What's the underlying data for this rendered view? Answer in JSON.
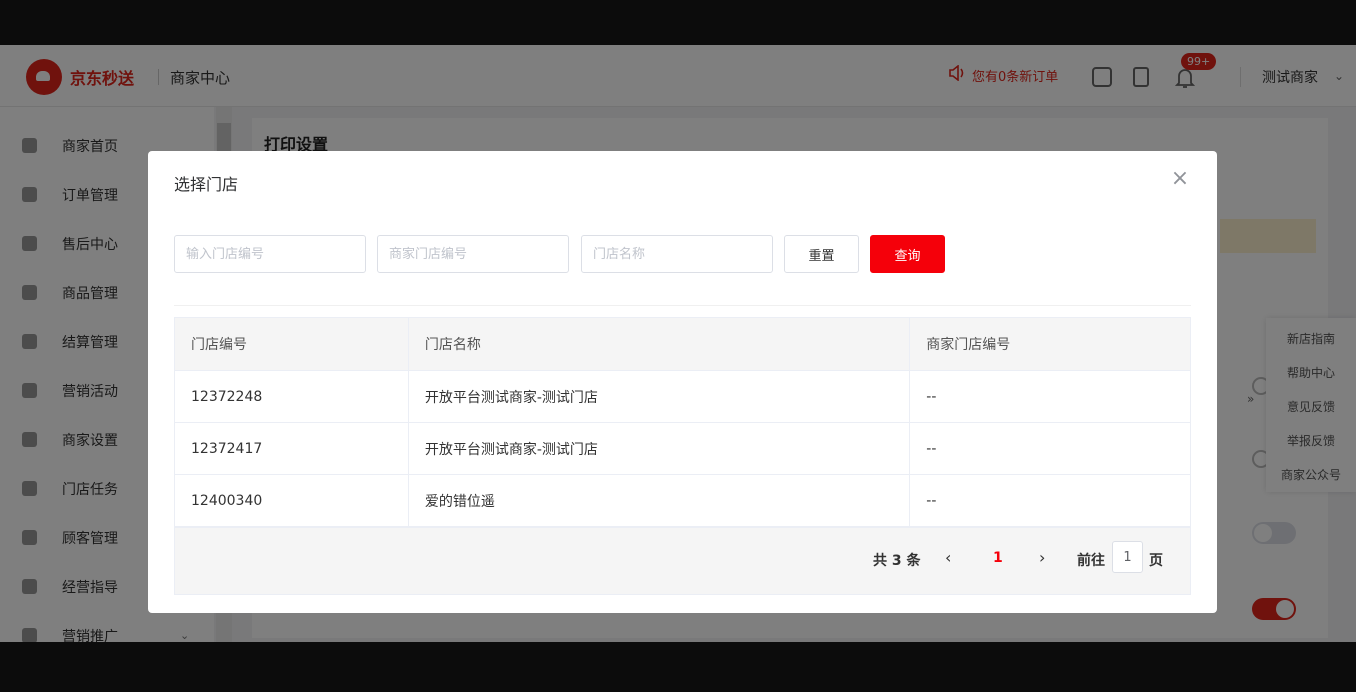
{
  "header": {
    "brand": "京东秒送",
    "subtitle": "商家中心",
    "notice": "您有0条新订单",
    "badge": "99+",
    "user": "测试商家"
  },
  "sidebar": {
    "items": [
      {
        "label": "商家首页"
      },
      {
        "label": "订单管理"
      },
      {
        "label": "售后中心"
      },
      {
        "label": "商品管理"
      },
      {
        "label": "结算管理"
      },
      {
        "label": "营销活动"
      },
      {
        "label": "商家设置"
      },
      {
        "label": "门店任务"
      },
      {
        "label": "顾客管理"
      },
      {
        "label": "经营指导"
      },
      {
        "label": "营销推广"
      }
    ]
  },
  "main": {
    "title": "打印设置"
  },
  "float_panel": {
    "items": [
      "新店指南",
      "帮助中心",
      "意见反馈",
      "举报反馈",
      "商家公众号"
    ],
    "collapse": "»"
  },
  "modal": {
    "title": "选择门店",
    "close": "×",
    "search": {
      "store_id_placeholder": "输入门店编号",
      "merchant_store_id_placeholder": "商家门店编号",
      "store_name_placeholder": "门店名称",
      "reset_label": "重置",
      "query_label": "查询"
    },
    "table": {
      "headers": [
        "门店编号",
        "门店名称",
        "商家门店编号"
      ],
      "rows": [
        [
          "12372248",
          "开放平台测试商家-测试门店",
          "--"
        ],
        [
          "12372417",
          "开放平台测试商家-测试门店",
          "--"
        ],
        [
          "12400340",
          "爱的错位遥",
          "--"
        ]
      ]
    },
    "pagination": {
      "total": "共 3 条",
      "prev": "‹",
      "current": "1",
      "next": "›",
      "goto_label": "前往",
      "page_value": "1",
      "page_label": "页"
    }
  },
  "colors": {
    "brand_red": "#e1251b",
    "query_red": "#f5000a",
    "toggle_on": "#e1251b",
    "toggle_off": "#dcdfe6"
  }
}
